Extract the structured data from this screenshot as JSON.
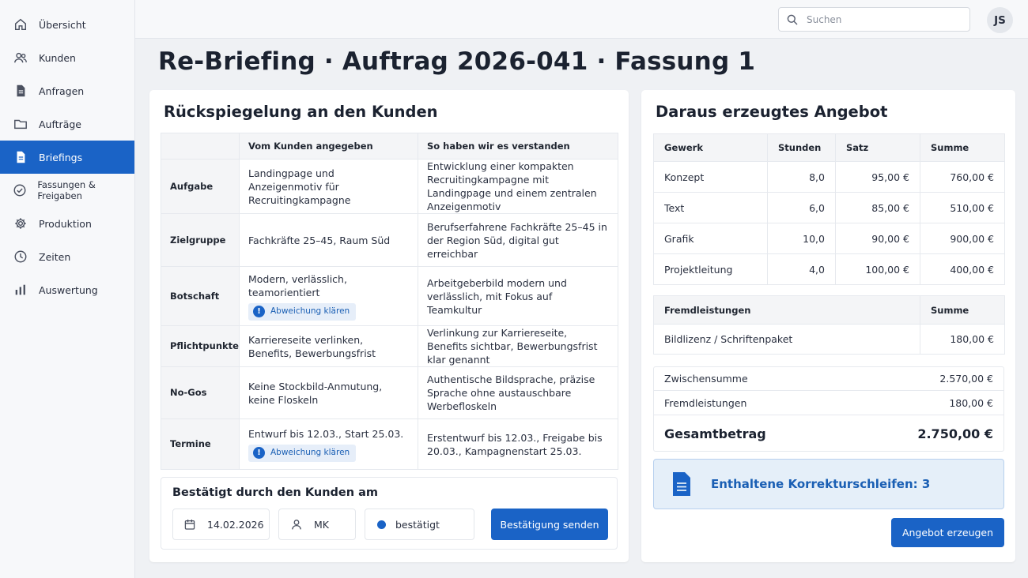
{
  "sidebar": {
    "items": [
      {
        "label": "Übersicht",
        "icon": "home-icon"
      },
      {
        "label": "Kunden",
        "icon": "users-icon"
      },
      {
        "label": "Anfragen",
        "icon": "document-icon"
      },
      {
        "label": "Aufträge",
        "icon": "folder-icon"
      },
      {
        "label": "Briefings",
        "icon": "document-icon",
        "active": true
      },
      {
        "label": "Fassungen & Freigaben",
        "icon": "check-circle-icon"
      },
      {
        "label": "Produktion",
        "icon": "gear-icon"
      },
      {
        "label": "Zeiten",
        "icon": "clock-icon"
      },
      {
        "label": "Auswertung",
        "icon": "bar-chart-icon"
      }
    ]
  },
  "header": {
    "search_placeholder": "Suchen",
    "avatar_initials": "JS"
  },
  "page": {
    "title": "Re-Briefing · Auftrag 2026-041 · Fassung 1"
  },
  "reflection": {
    "title": "Rückspiegelung an den Kunden",
    "columns": [
      "",
      "Vom Kunden angegeben",
      "So haben wir es verstanden"
    ],
    "rows": [
      {
        "label": "Aufgabe",
        "given": "Landingpage und Anzeigenmotiv für Recruitingkampagne",
        "understood": "Entwicklung einer kompakten Recruitingkampagne mit Landingpage und einem zentralen Anzeigenmotiv"
      },
      {
        "label": "Zielgruppe",
        "given": "Fachkräfte 25–45, Raum Süd",
        "understood": "Berufserfahrene Fachkräfte 25–45 in der Region Süd, digital gut erreichbar"
      },
      {
        "label": "Botschaft",
        "given": "Modern, verlässlich, teamorientiert",
        "understood": "Arbeitgeberbild modern und verlässlich, mit Fokus auf Teamkultur",
        "badge": "Abweichung klären"
      },
      {
        "label": "Pflichtpunkte",
        "given": "Karriereseite verlinken, Benefits, Bewerbungsfrist",
        "understood": "Verlinkung zur Karriereseite, Benefits sichtbar, Bewerbungsfrist klar genannt"
      },
      {
        "label": "No-Gos",
        "given": "Keine Stockbild-Anmutung, keine Floskeln",
        "understood": "Authentische Bildsprache, präzise Sprache ohne austauschbare Werbefloskeln"
      },
      {
        "label": "Termine",
        "given": "Entwurf bis 12.03., Start 25.03.",
        "understood": "Erstentwurf bis 12.03., Freigabe bis 20.03., Kampagnenstart 25.03.",
        "badge": "Abweichung klären"
      }
    ],
    "confirm": {
      "title": "Bestätigt durch den Kunden am",
      "date": "14.02.2026",
      "user": "MK",
      "status": "bestätigt",
      "button": "Bestätigung senden"
    }
  },
  "offer": {
    "title": "Daraus erzeugtes Angebot",
    "work_columns": [
      "Gewerk",
      "Stunden",
      "Satz",
      "Summe"
    ],
    "work_rows": [
      {
        "trade": "Konzept",
        "hours": "8,0",
        "rate": "95,00 €",
        "sum": "760,00 €"
      },
      {
        "trade": "Text",
        "hours": "6,0",
        "rate": "85,00 €",
        "sum": "510,00 €"
      },
      {
        "trade": "Grafik",
        "hours": "10,0",
        "rate": "90,00 €",
        "sum": "900,00 €"
      },
      {
        "trade": "Projektleitung",
        "hours": "4,0",
        "rate": "100,00 €",
        "sum": "400,00 €"
      }
    ],
    "ext_columns": [
      "Fremdleistungen",
      "Summe"
    ],
    "ext_rows": [
      {
        "item": "Bildlizenz / Schriftenpaket",
        "sum": "180,00 €"
      }
    ],
    "subtotal_label": "Zwischensumme",
    "subtotal": "2.570,00 €",
    "ext_label": "Fremdleistungen",
    "ext_total": "180,00 €",
    "total_label": "Gesamtbetrag",
    "total": "2.750,00 €",
    "info": "Enthaltene Korrekturschleifen: 3",
    "button": "Angebot erzeugen"
  },
  "colors": {
    "accent": "#1a63c6",
    "info_bg": "#e5eff9"
  }
}
